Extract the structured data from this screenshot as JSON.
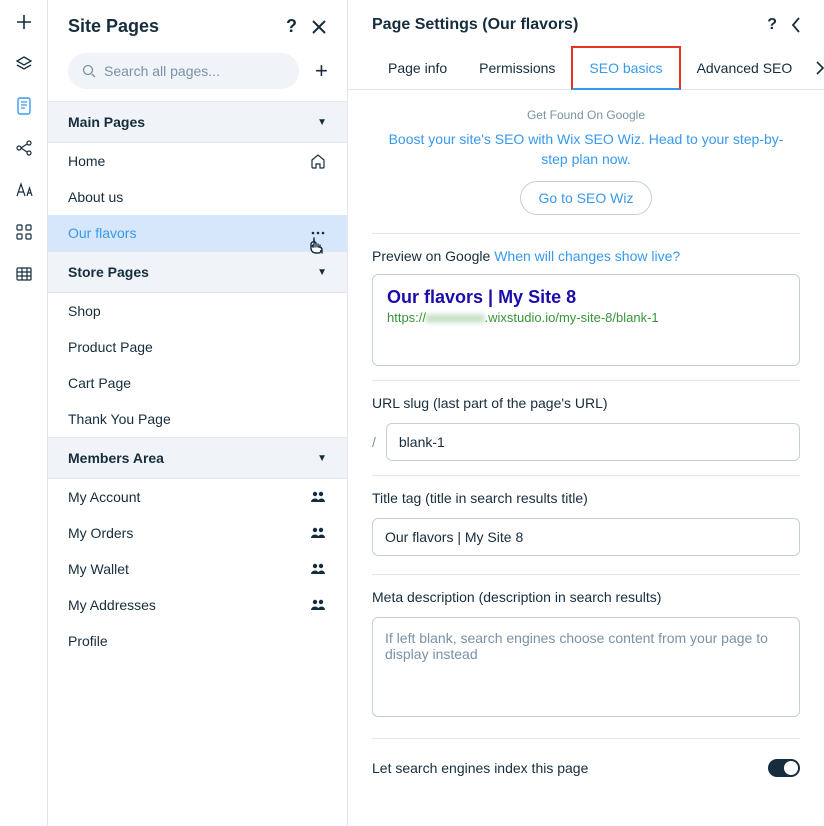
{
  "pages_panel": {
    "title": "Site Pages",
    "search_placeholder": "Search all pages...",
    "sections": {
      "main": {
        "label": "Main Pages",
        "items": [
          {
            "label": "Home",
            "icon": "home"
          },
          {
            "label": "About us"
          },
          {
            "label": "Our flavors",
            "selected": true,
            "icon": "more"
          }
        ]
      },
      "store": {
        "label": "Store Pages",
        "items": [
          {
            "label": "Shop"
          },
          {
            "label": "Product Page"
          },
          {
            "label": "Cart Page"
          },
          {
            "label": "Thank You Page"
          }
        ]
      },
      "members": {
        "label": "Members Area",
        "items": [
          {
            "label": "My Account",
            "icon": "members"
          },
          {
            "label": "My Orders",
            "icon": "members"
          },
          {
            "label": "My Wallet",
            "icon": "members"
          },
          {
            "label": "My Addresses",
            "icon": "members"
          },
          {
            "label": "Profile"
          }
        ]
      }
    }
  },
  "settings_panel": {
    "title": "Page Settings (Our flavors)",
    "tabs": [
      {
        "label": "Page info"
      },
      {
        "label": "Permissions"
      },
      {
        "label": "SEO basics",
        "active": true
      },
      {
        "label": "Advanced SEO"
      }
    ],
    "promo": {
      "small": "Get Found On Google",
      "text": "Boost your site's SEO with Wix SEO Wiz. Head to your step-by-step plan now.",
      "button": "Go to SEO Wiz"
    },
    "preview": {
      "label": "Preview on Google ",
      "link": "When will changes show live?",
      "title": "Our flavors | My Site 8",
      "url_prefix": "https://",
      "url_blur": "xxxxxxxxx",
      "url_suffix": ".wixstudio.io/my-site-8/blank-1"
    },
    "url_slug": {
      "label": "URL slug (last part of the page's URL)",
      "prefix": "/",
      "value": "blank-1"
    },
    "title_tag": {
      "label": "Title tag (title in search results title)",
      "value": "Our flavors | My Site 8"
    },
    "meta": {
      "label": "Meta description (description in search results)",
      "placeholder": "If left blank, search engines choose content from your page to display instead"
    },
    "index_toggle": {
      "label": "Let search engines index this page",
      "value": true
    }
  }
}
